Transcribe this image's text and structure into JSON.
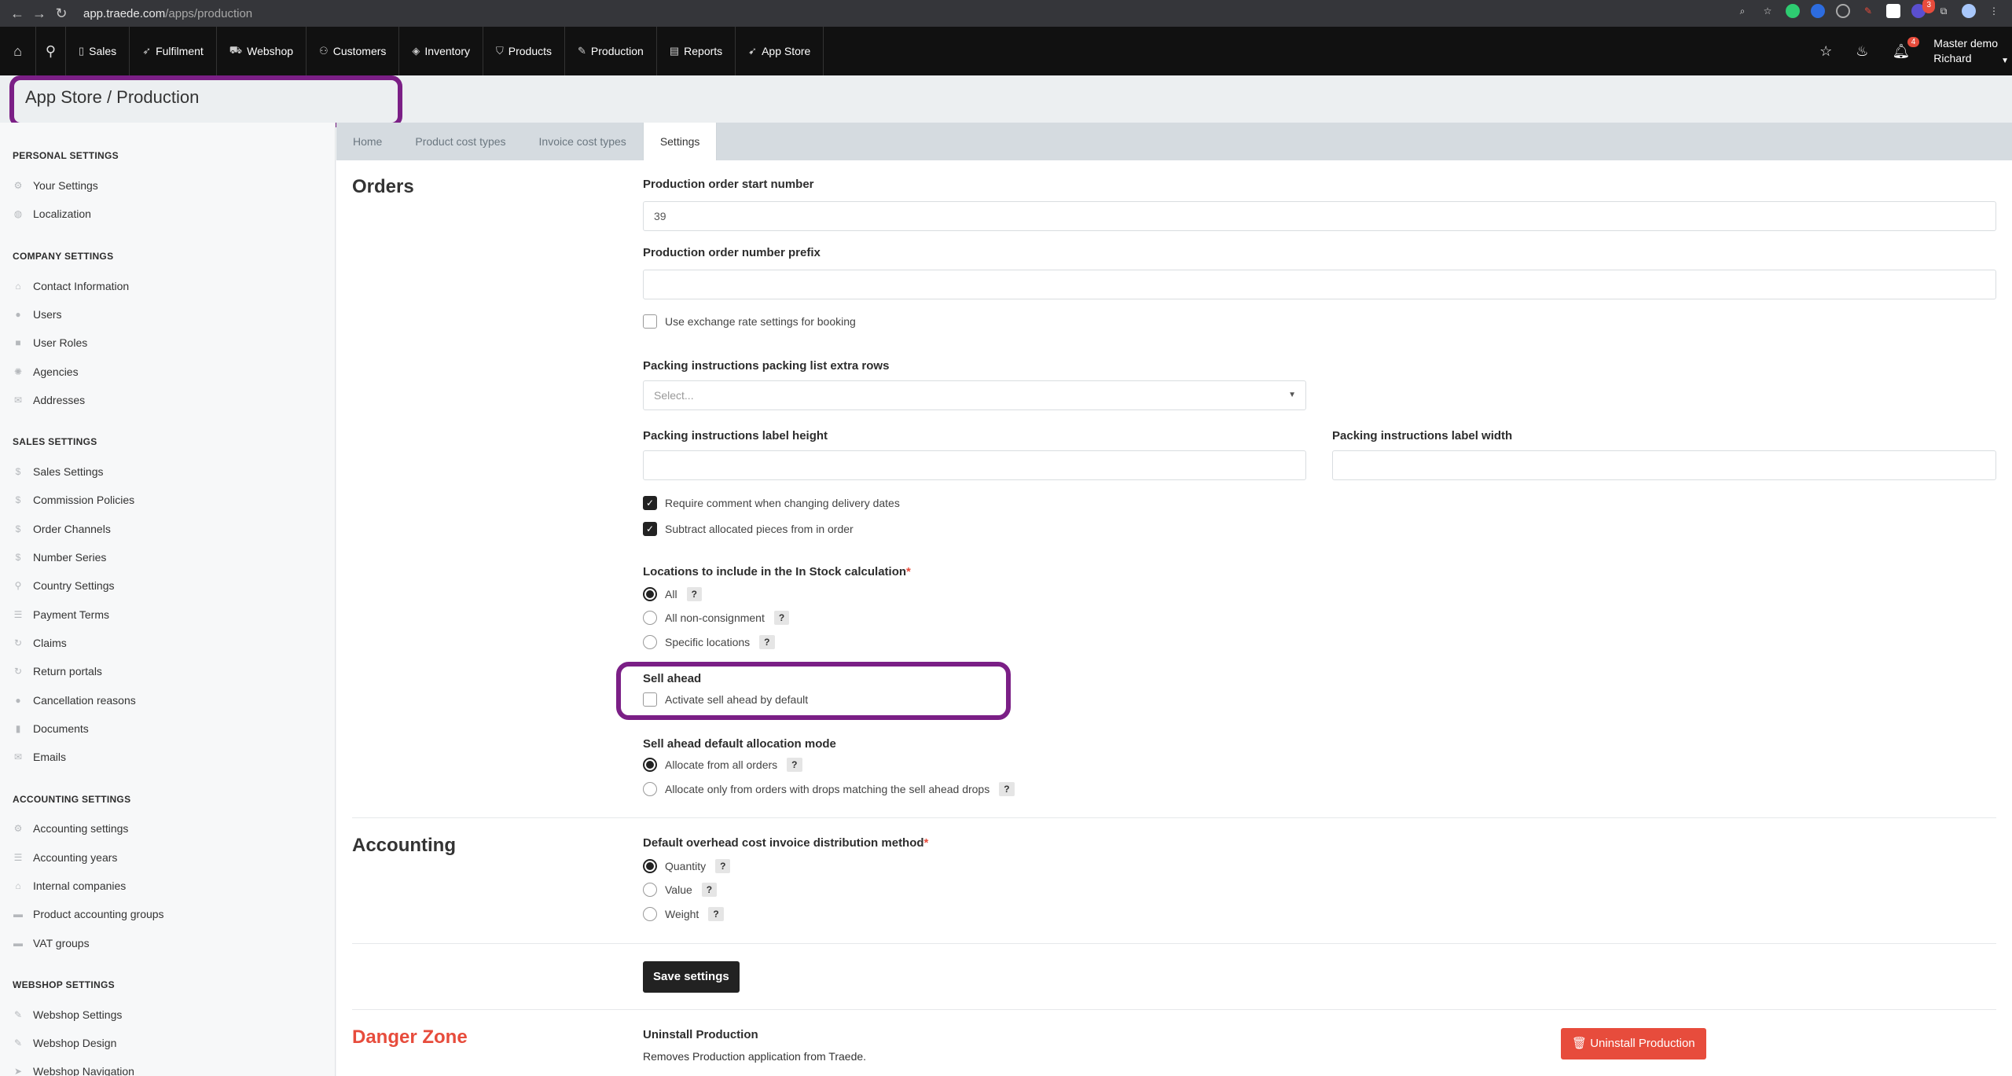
{
  "browser": {
    "url_host": "app.traede.com",
    "url_path": "/apps/production",
    "notification_count": "3"
  },
  "topnav": {
    "items": [
      {
        "label": "Sales",
        "icon": "file-icon"
      },
      {
        "label": "Fulfilment",
        "icon": "plane-icon"
      },
      {
        "label": "Webshop",
        "icon": "cart-icon"
      },
      {
        "label": "Customers",
        "icon": "users-icon"
      },
      {
        "label": "Inventory",
        "icon": "layers-icon"
      },
      {
        "label": "Products",
        "icon": "shirt-icon"
      },
      {
        "label": "Production",
        "icon": "pencil-icon"
      },
      {
        "label": "Reports",
        "icon": "chart-icon"
      },
      {
        "label": "App Store",
        "icon": "rocket-icon"
      }
    ],
    "notifications": "4",
    "user_line1": "Master demo",
    "user_line2": "Richard"
  },
  "page_title": "App Store / Production",
  "sidebar": {
    "personal": {
      "heading": "PERSONAL SETTINGS",
      "items": [
        "Your Settings",
        "Localization"
      ]
    },
    "company": {
      "heading": "COMPANY SETTINGS",
      "items": [
        "Contact Information",
        "Users",
        "User Roles",
        "Agencies",
        "Addresses"
      ]
    },
    "sales": {
      "heading": "SALES SETTINGS",
      "items": [
        "Sales Settings",
        "Commission Policies",
        "Order Channels",
        "Number Series",
        "Country Settings",
        "Payment Terms",
        "Claims",
        "Return portals",
        "Cancellation reasons",
        "Documents",
        "Emails"
      ]
    },
    "accounting": {
      "heading": "ACCOUNTING SETTINGS",
      "items": [
        "Accounting settings",
        "Accounting years",
        "Internal companies",
        "Product accounting groups",
        "VAT groups"
      ]
    },
    "webshop": {
      "heading": "WEBSHOP SETTINGS",
      "items": [
        "Webshop Settings",
        "Webshop Design",
        "Webshop Navigation"
      ]
    }
  },
  "tabs": [
    "Home",
    "Product cost types",
    "Invoice cost types",
    "Settings"
  ],
  "orders": {
    "title": "Orders",
    "start_number_label": "Production order start number",
    "start_number_value": "39",
    "prefix_label": "Production order number prefix",
    "prefix_value": "",
    "exchange_label": "Use exchange rate settings for booking",
    "extra_rows_label": "Packing instructions packing list extra rows",
    "extra_rows_placeholder": "Select...",
    "label_height_label": "Packing instructions label height",
    "label_width_label": "Packing instructions label width",
    "require_comment_label": "Require comment when changing delivery dates",
    "subtract_label": "Subtract allocated pieces from in order",
    "locations_label": "Locations to include in the In Stock calculation",
    "locations_options": [
      "All",
      "All non-consignment",
      "Specific locations"
    ],
    "sell_ahead_title": "Sell ahead",
    "sell_ahead_label": "Activate sell ahead by default",
    "alloc_mode_label": "Sell ahead default allocation mode",
    "alloc_options": [
      "Allocate from all orders",
      "Allocate only from orders with drops matching the sell ahead drops"
    ]
  },
  "accounting": {
    "title": "Accounting",
    "method_label": "Default overhead cost invoice distribution method",
    "method_options": [
      "Quantity",
      "Value",
      "Weight"
    ]
  },
  "save_label": "Save settings",
  "danger": {
    "title": "Danger Zone",
    "uninstall_title": "Uninstall Production",
    "uninstall_desc": "Removes Production application from Traede.",
    "uninstall_button": "Uninstall Production"
  },
  "help_mark": "?",
  "required_mark": "*"
}
